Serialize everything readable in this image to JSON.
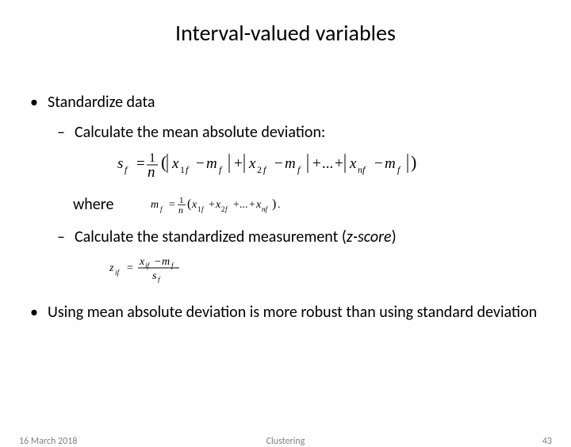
{
  "title": "Interval-valued variables",
  "bullets": {
    "b1a": "Standardize data",
    "b2a": "Calculate the mean absolute deviation:",
    "where": "where",
    "b2b_pre": "Calculate the standardized measurement (",
    "b2b_em": "z-score",
    "b2b_post": ")",
    "b1b": "Using mean absolute deviation is more robust than using standard deviation"
  },
  "footer": {
    "date": "16 March 2018",
    "title": "Clustering",
    "page": "43"
  }
}
